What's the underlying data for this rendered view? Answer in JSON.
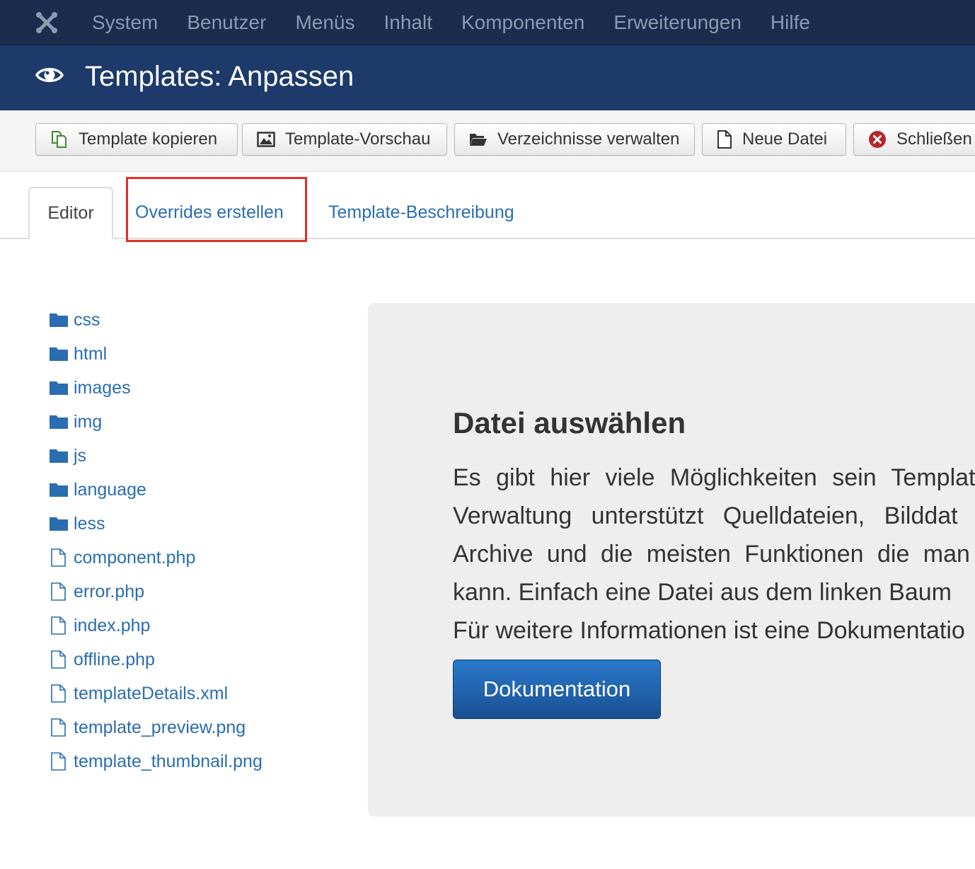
{
  "topnav": {
    "logo_icon": "joomla-logo-icon",
    "items": [
      "System",
      "Benutzer",
      "Menüs",
      "Inhalt",
      "Komponenten",
      "Erweiterungen",
      "Hilfe"
    ]
  },
  "header": {
    "icon": "eye-icon",
    "title": "Templates: Anpassen"
  },
  "toolbar": {
    "buttons": [
      {
        "label": "Template kopieren",
        "icon": "copy-icon"
      },
      {
        "label": "Template-Vorschau",
        "icon": "image-icon"
      },
      {
        "label": "Verzeichnisse verwalten",
        "icon": "folder-open-icon"
      },
      {
        "label": "Neue Datei",
        "icon": "file-icon"
      },
      {
        "label": "Schließen",
        "icon": "close-icon"
      }
    ]
  },
  "tabs": [
    {
      "label": "Editor",
      "active": true
    },
    {
      "label": "Overrides erstellen",
      "active": false,
      "highlighted": true
    },
    {
      "label": "Template-Beschreibung",
      "active": false
    }
  ],
  "file_tree": {
    "folders": [
      "css",
      "html",
      "images",
      "img",
      "js",
      "language",
      "less"
    ],
    "files": [
      "component.php",
      "error.php",
      "index.php",
      "offline.php",
      "templateDetails.xml",
      "template_preview.png",
      "template_thumbnail.png"
    ]
  },
  "panel": {
    "heading": "Datei auswählen",
    "paragraph_lines": [
      "Es gibt hier viele Möglichkeiten sein Template",
      "Verwaltung unterstützt Quelldateien, Bilddat",
      "Archive und die meisten Funktionen die man",
      "kann. Einfach eine Datei aus dem linken Baum",
      "Für weitere Informationen ist eine Dokumentatio"
    ],
    "button_label": "Dokumentation"
  },
  "colors": {
    "topnav_bg": "#1b2d4d",
    "titlebar_bg": "#1d3a6a",
    "link": "#2a6db0",
    "highlight": "#e0302a",
    "primary_button": "#1f5fa8"
  }
}
